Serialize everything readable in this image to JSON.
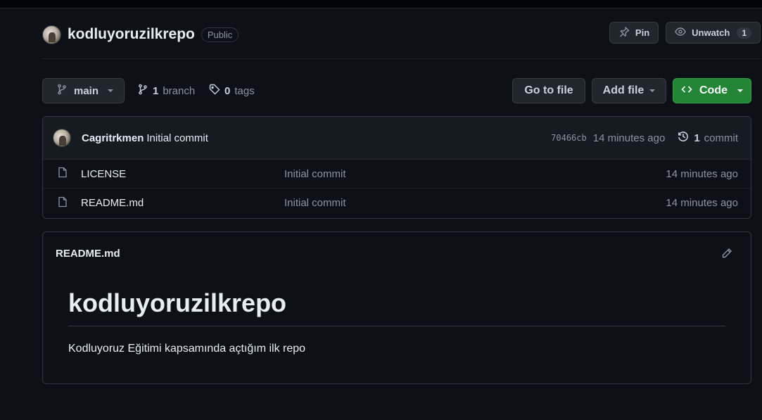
{
  "repo": {
    "name": "kodluyoruzilkrepo",
    "visibility": "Public"
  },
  "actions": {
    "pin_label": "Pin",
    "unwatch_label": "Unwatch",
    "watch_count": "1"
  },
  "branch_bar": {
    "current_branch": "main",
    "branch_count": "1",
    "branch_word": "branch",
    "tag_count": "0",
    "tag_word": "tags",
    "go_to_file_label": "Go to file",
    "add_file_label": "Add file",
    "code_label": "Code"
  },
  "latest_commit": {
    "author": "Cagritrkmen",
    "message": "Initial commit",
    "sha": "70466cb",
    "age": "14 minutes ago",
    "commit_count": "1",
    "commit_word": "commit"
  },
  "files": [
    {
      "name": "LICENSE",
      "message": "Initial commit",
      "age": "14 minutes ago"
    },
    {
      "name": "README.md",
      "message": "Initial commit",
      "age": "14 minutes ago"
    }
  ],
  "readme": {
    "filename": "README.md",
    "heading": "kodluyoruzilkrepo",
    "body": "Kodluyoruz Eğitimi kapsamında açtığım ilk repo"
  },
  "colors": {
    "background": "#0d1117",
    "code_button": "#238636",
    "border": "#30363d"
  }
}
